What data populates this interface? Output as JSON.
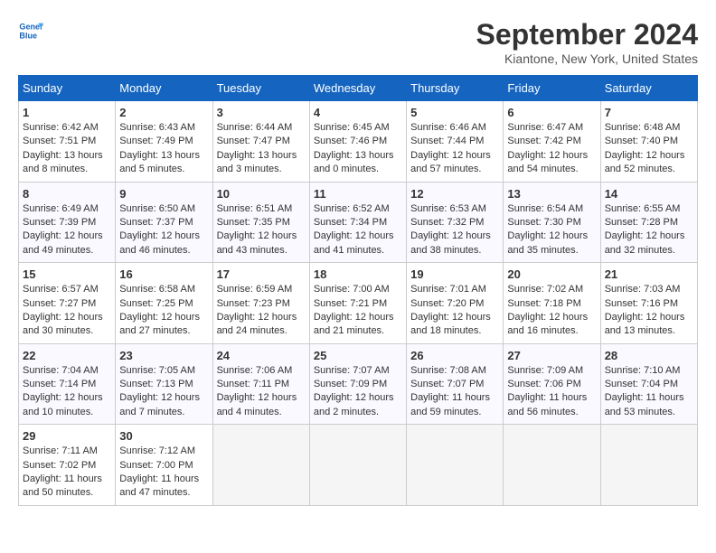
{
  "header": {
    "logo_line1": "General",
    "logo_line2": "Blue",
    "title": "September 2024",
    "subtitle": "Kiantone, New York, United States"
  },
  "days_of_week": [
    "Sunday",
    "Monday",
    "Tuesday",
    "Wednesday",
    "Thursday",
    "Friday",
    "Saturday"
  ],
  "weeks": [
    [
      {
        "day": 1,
        "sunrise": "6:42 AM",
        "sunset": "7:51 PM",
        "daylight": "13 hours and 8 minutes."
      },
      {
        "day": 2,
        "sunrise": "6:43 AM",
        "sunset": "7:49 PM",
        "daylight": "13 hours and 5 minutes."
      },
      {
        "day": 3,
        "sunrise": "6:44 AM",
        "sunset": "7:47 PM",
        "daylight": "13 hours and 3 minutes."
      },
      {
        "day": 4,
        "sunrise": "6:45 AM",
        "sunset": "7:46 PM",
        "daylight": "13 hours and 0 minutes."
      },
      {
        "day": 5,
        "sunrise": "6:46 AM",
        "sunset": "7:44 PM",
        "daylight": "12 hours and 57 minutes."
      },
      {
        "day": 6,
        "sunrise": "6:47 AM",
        "sunset": "7:42 PM",
        "daylight": "12 hours and 54 minutes."
      },
      {
        "day": 7,
        "sunrise": "6:48 AM",
        "sunset": "7:40 PM",
        "daylight": "12 hours and 52 minutes."
      }
    ],
    [
      {
        "day": 8,
        "sunrise": "6:49 AM",
        "sunset": "7:39 PM",
        "daylight": "12 hours and 49 minutes."
      },
      {
        "day": 9,
        "sunrise": "6:50 AM",
        "sunset": "7:37 PM",
        "daylight": "12 hours and 46 minutes."
      },
      {
        "day": 10,
        "sunrise": "6:51 AM",
        "sunset": "7:35 PM",
        "daylight": "12 hours and 43 minutes."
      },
      {
        "day": 11,
        "sunrise": "6:52 AM",
        "sunset": "7:34 PM",
        "daylight": "12 hours and 41 minutes."
      },
      {
        "day": 12,
        "sunrise": "6:53 AM",
        "sunset": "7:32 PM",
        "daylight": "12 hours and 38 minutes."
      },
      {
        "day": 13,
        "sunrise": "6:54 AM",
        "sunset": "7:30 PM",
        "daylight": "12 hours and 35 minutes."
      },
      {
        "day": 14,
        "sunrise": "6:55 AM",
        "sunset": "7:28 PM",
        "daylight": "12 hours and 32 minutes."
      }
    ],
    [
      {
        "day": 15,
        "sunrise": "6:57 AM",
        "sunset": "7:27 PM",
        "daylight": "12 hours and 30 minutes."
      },
      {
        "day": 16,
        "sunrise": "6:58 AM",
        "sunset": "7:25 PM",
        "daylight": "12 hours and 27 minutes."
      },
      {
        "day": 17,
        "sunrise": "6:59 AM",
        "sunset": "7:23 PM",
        "daylight": "12 hours and 24 minutes."
      },
      {
        "day": 18,
        "sunrise": "7:00 AM",
        "sunset": "7:21 PM",
        "daylight": "12 hours and 21 minutes."
      },
      {
        "day": 19,
        "sunrise": "7:01 AM",
        "sunset": "7:20 PM",
        "daylight": "12 hours and 18 minutes."
      },
      {
        "day": 20,
        "sunrise": "7:02 AM",
        "sunset": "7:18 PM",
        "daylight": "12 hours and 16 minutes."
      },
      {
        "day": 21,
        "sunrise": "7:03 AM",
        "sunset": "7:16 PM",
        "daylight": "12 hours and 13 minutes."
      }
    ],
    [
      {
        "day": 22,
        "sunrise": "7:04 AM",
        "sunset": "7:14 PM",
        "daylight": "12 hours and 10 minutes."
      },
      {
        "day": 23,
        "sunrise": "7:05 AM",
        "sunset": "7:13 PM",
        "daylight": "12 hours and 7 minutes."
      },
      {
        "day": 24,
        "sunrise": "7:06 AM",
        "sunset": "7:11 PM",
        "daylight": "12 hours and 4 minutes."
      },
      {
        "day": 25,
        "sunrise": "7:07 AM",
        "sunset": "7:09 PM",
        "daylight": "12 hours and 2 minutes."
      },
      {
        "day": 26,
        "sunrise": "7:08 AM",
        "sunset": "7:07 PM",
        "daylight": "11 hours and 59 minutes."
      },
      {
        "day": 27,
        "sunrise": "7:09 AM",
        "sunset": "7:06 PM",
        "daylight": "11 hours and 56 minutes."
      },
      {
        "day": 28,
        "sunrise": "7:10 AM",
        "sunset": "7:04 PM",
        "daylight": "11 hours and 53 minutes."
      }
    ],
    [
      {
        "day": 29,
        "sunrise": "7:11 AM",
        "sunset": "7:02 PM",
        "daylight": "11 hours and 50 minutes."
      },
      {
        "day": 30,
        "sunrise": "7:12 AM",
        "sunset": "7:00 PM",
        "daylight": "11 hours and 47 minutes."
      },
      null,
      null,
      null,
      null,
      null
    ]
  ]
}
